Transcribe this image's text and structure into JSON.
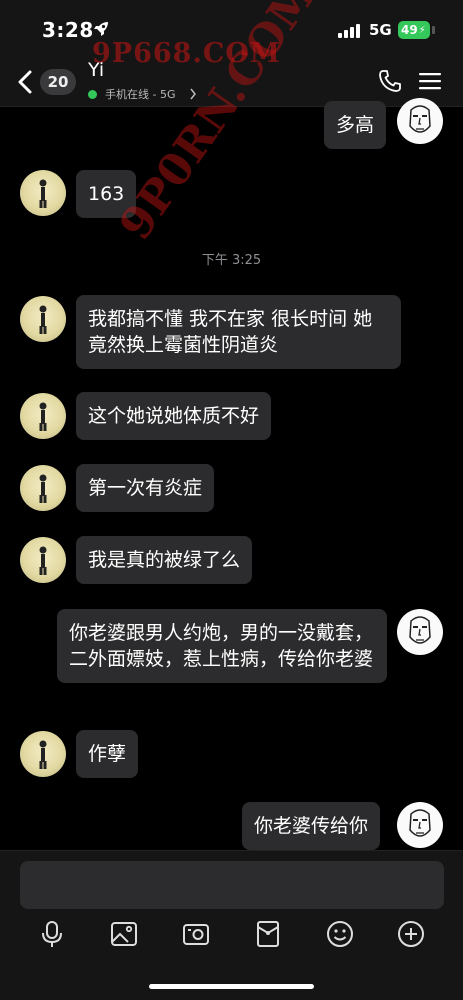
{
  "status": {
    "time": "3:28",
    "network": "5G",
    "battery": "49"
  },
  "header": {
    "back_badge": "20",
    "contact_name": "Yi",
    "subtitle": "手机在线 - 5G"
  },
  "watermark": {
    "top": "9P668.COM",
    "diagonal": "9P0RN.COM"
  },
  "messages": [
    {
      "side": "me",
      "text": "多高"
    },
    {
      "side": "them",
      "text": "163"
    },
    {
      "side": "them",
      "text": "我都搞不懂 我不在家 很长时间 她竟然换上霉菌性阴道炎"
    },
    {
      "side": "them",
      "text": "这个她说她体质不好"
    },
    {
      "side": "them",
      "text": "第一次有炎症"
    },
    {
      "side": "them",
      "text": "我是真的被绿了么"
    },
    {
      "side": "me",
      "text": "你老婆跟男人约炮，男的一没戴套，二外面嫖妓，惹上性病，传给你老婆"
    },
    {
      "side": "them",
      "text": "作孽"
    },
    {
      "side": "me",
      "text": "你老婆传给你"
    }
  ],
  "timestamp": "下午 3:25",
  "toolbar": {
    "icons": [
      "microphone-icon",
      "image-icon",
      "camera-icon",
      "red-packet-icon",
      "emoji-icon",
      "plus-icon"
    ]
  },
  "colors": {
    "background": "#000000",
    "bubble": "#2c2c2e",
    "online": "#34c759",
    "watermark": "#c81414"
  }
}
